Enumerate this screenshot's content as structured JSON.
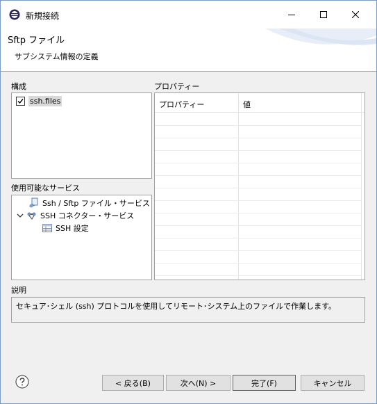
{
  "window": {
    "title": "新規接続",
    "controls": [
      "minimize-icon",
      "maximize-icon",
      "close-icon"
    ]
  },
  "header": {
    "title": "Sftp ファイル",
    "description": "サブシステム情報の定義"
  },
  "composition": {
    "label": "構成",
    "items": [
      {
        "label": "ssh.files",
        "checked": true
      }
    ]
  },
  "services": {
    "label": "使用可能なサービス",
    "items": [
      {
        "label": "Ssh / Sftp ファイル・サービス",
        "icon": "file-service-icon",
        "expanded": false
      },
      {
        "label": "SSH コネクター・サービス",
        "icon": "connector-service-icon",
        "expanded": true
      },
      {
        "label": "SSH 設定",
        "icon": "table-icon",
        "indent": 2
      }
    ]
  },
  "properties": {
    "label": "プロパティー",
    "columns": [
      "プロパティー",
      "値"
    ]
  },
  "description": {
    "label": "説明",
    "text": "セキュア･シェル (ssh) プロトコルを使用してリモート･システム上のファイルで作業します。"
  },
  "buttons": {
    "back": "< 戻る(B)",
    "next": "次へ(N) >",
    "finish": "完了(F)",
    "cancel": "キャンセル"
  },
  "colors": {
    "accent": "#0078d7",
    "border": "#a0a0a0",
    "dialog_bg": "#f0f0f0"
  }
}
